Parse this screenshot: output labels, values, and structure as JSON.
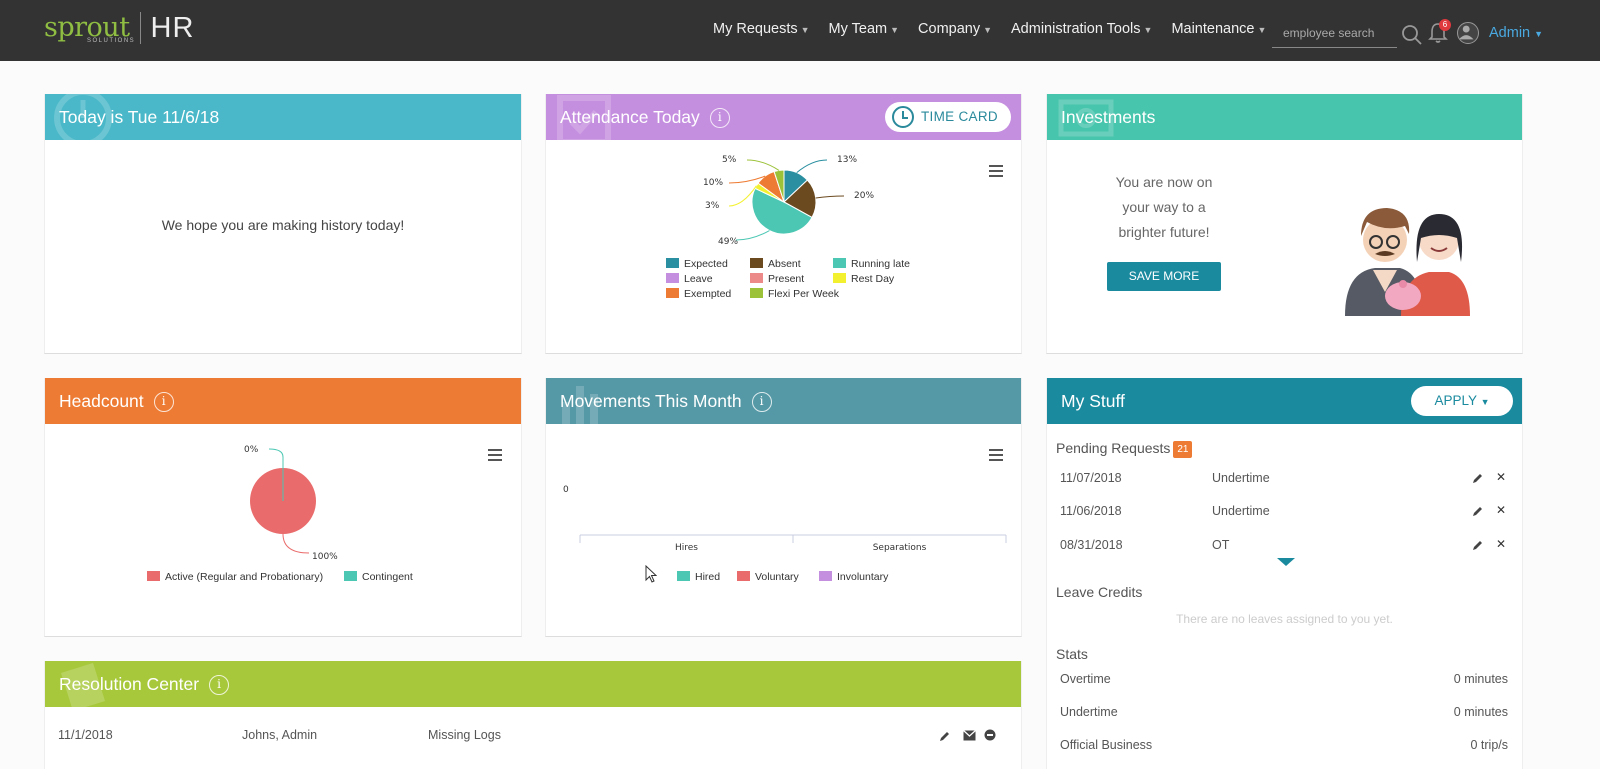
{
  "nav": {
    "logo_main": "sprout",
    "logo_sub": "SOLUTIONS",
    "logo_hr": "HR",
    "menu": [
      "My Requests",
      "My Team",
      "Company",
      "Administration Tools",
      "Maintenance"
    ],
    "search_placeholder": "employee search",
    "notification_count": "6",
    "user": "Admin"
  },
  "today": {
    "title": "Today is Tue 11/6/18",
    "message": "We hope you are making history today!"
  },
  "attendance": {
    "title": "Attendance Today",
    "time_card_label": "TIME CARD",
    "info": "i"
  },
  "investments": {
    "title": "Investments",
    "message": "You are now on your way to a brighter future!",
    "button": "SAVE MORE"
  },
  "headcount": {
    "title": "Headcount",
    "info": "i"
  },
  "movements": {
    "title": "Movements This Month",
    "info": "i"
  },
  "my_stuff": {
    "title": "My Stuff",
    "apply_label": "APPLY",
    "pending_title": "Pending Requests",
    "pending_count": "21",
    "requests": [
      {
        "date": "11/07/2018",
        "type": "Undertime"
      },
      {
        "date": "11/06/2018",
        "type": "Undertime"
      },
      {
        "date": "08/31/2018",
        "type": "OT"
      }
    ],
    "leave_title": "Leave Credits",
    "leave_empty": "There are no leaves assigned to you yet.",
    "stats_title": "Stats",
    "stats": [
      {
        "label": "Overtime",
        "value": "0 minutes"
      },
      {
        "label": "Undertime",
        "value": "0 minutes"
      },
      {
        "label": "Official Business",
        "value": "0 trip/s"
      }
    ]
  },
  "resolution": {
    "title": "Resolution Center",
    "info": "i",
    "rows": [
      {
        "date": "11/1/2018",
        "name": "Johns, Admin",
        "issue": "Missing Logs"
      }
    ]
  },
  "colors": {
    "today": "#4ab8c8",
    "attendance": "#c58fdf",
    "investments": "#48c5ad",
    "headcount": "#ee7b33",
    "movements": "#5599a6",
    "my_stuff": "#1a8a9f",
    "resolution": "#a8c83c"
  },
  "chart_data": [
    {
      "type": "pie",
      "title": "",
      "categories": [
        "Expected",
        "Absent",
        "Running late",
        "Leave",
        "Present",
        "Rest Day",
        "Exempted",
        "Flexi Per Week"
      ],
      "values": [
        13,
        20,
        49,
        0,
        0,
        3,
        10,
        5
      ],
      "labels": [
        "13%",
        "20%",
        "49%",
        "3%",
        "10%",
        "5%"
      ],
      "colors": [
        "#2a8fa0",
        "#6b4a1f",
        "#4cc7b3",
        "#c58fdf",
        "#ec8a8a",
        "#f3f12f",
        "#ee7b33",
        "#9cc23a"
      ],
      "legend": "bottom"
    },
    {
      "type": "pie",
      "title": "",
      "categories": [
        "Active (Regular and Probationary)",
        "Contingent"
      ],
      "values": [
        100,
        0
      ],
      "labels": [
        "100%",
        "0%"
      ],
      "colors": [
        "#ea6b6b",
        "#4cc7b3"
      ],
      "legend": "bottom"
    },
    {
      "type": "bar",
      "title": "",
      "categories": [
        "Hires",
        "Separations"
      ],
      "series": [
        {
          "name": "Hired",
          "values": [
            0,
            0
          ]
        },
        {
          "name": "Voluntary",
          "values": [
            0,
            0
          ]
        },
        {
          "name": "Involuntary",
          "values": [
            0,
            0
          ]
        }
      ],
      "y_tick": "0",
      "colors": [
        "#4cc7b3",
        "#ea6b6b",
        "#c58fdf"
      ],
      "legend": "bottom"
    }
  ]
}
